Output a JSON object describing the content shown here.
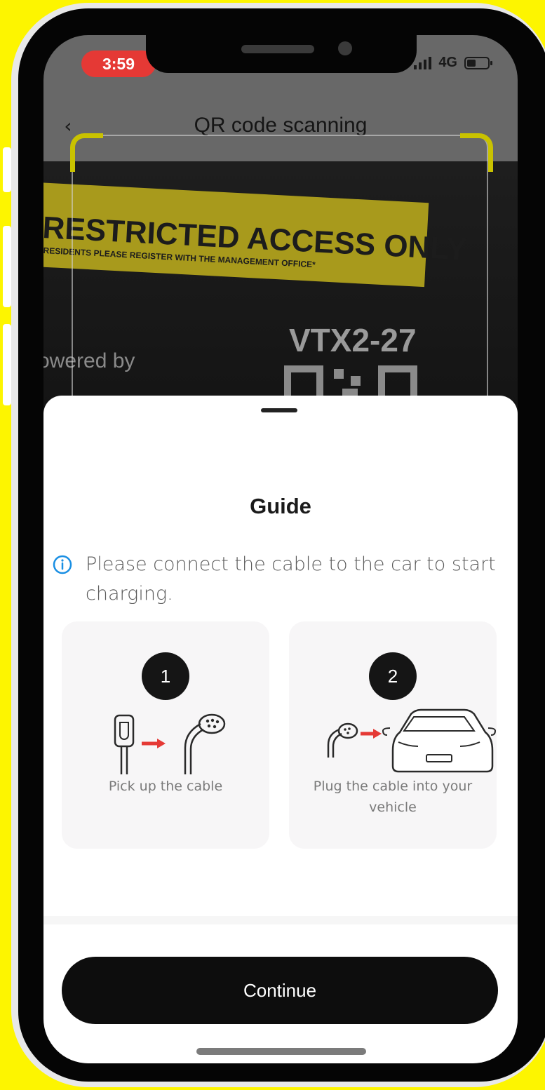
{
  "status_bar": {
    "time": "3:59",
    "network": "4G"
  },
  "header": {
    "back_icon": "chevron-left-icon",
    "title": "QR code scanning"
  },
  "camera_view": {
    "sign_title": "RESTRICTED ACCESS ONLY",
    "sign_subtitle": "RESIDENTS PLEASE REGISTER WITH THE MANAGEMENT OFFICE*",
    "powered_text": "owered by",
    "charger_code": "VTX2-27"
  },
  "sheet": {
    "title": "Guide",
    "info_icon": "info-circle-icon",
    "info_text": "Please connect the cable to the car to start charging.",
    "steps": [
      {
        "number": "1",
        "caption": "Pick up the cable"
      },
      {
        "number": "2",
        "caption": "Plug the cable into your vehicle"
      }
    ],
    "continue_label": "Continue"
  },
  "colors": {
    "accent": "#c9c200",
    "arrow": "#e53935",
    "button": "#0d0d0d",
    "background": "#fdf500"
  }
}
